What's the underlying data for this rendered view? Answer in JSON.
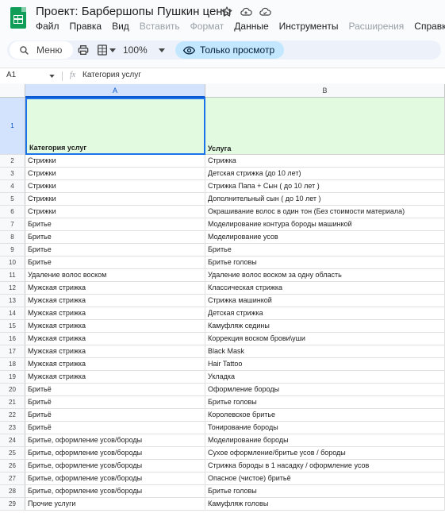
{
  "app": {
    "title": "Проект: Барбершопы Пушкин цены",
    "menus": [
      {
        "label": "Файл",
        "dim": false
      },
      {
        "label": "Правка",
        "dim": false
      },
      {
        "label": "Вид",
        "dim": false
      },
      {
        "label": "Вставить",
        "dim": true
      },
      {
        "label": "Формат",
        "dim": true
      },
      {
        "label": "Данные",
        "dim": false
      },
      {
        "label": "Инструменты",
        "dim": false
      },
      {
        "label": "Расширения",
        "dim": true
      },
      {
        "label": "Справка",
        "dim": false
      }
    ]
  },
  "toolbar": {
    "search_label": "Меню",
    "zoom": "100%",
    "view_only_label": "Только просмотр"
  },
  "formula_bar": {
    "cell_ref": "A1",
    "fx": "fx",
    "value": "Категория услуг"
  },
  "sheet": {
    "columns": [
      "A",
      "B"
    ],
    "header_row_number": "1",
    "headers": [
      "Категория услуг",
      "Услуга"
    ],
    "rows": [
      {
        "num": "2",
        "a": "Стрижки",
        "b": "Стрижка"
      },
      {
        "num": "3",
        "a": "Стрижки",
        "b": "Детская стрижка (до 10 лет)"
      },
      {
        "num": "4",
        "a": "Стрижки",
        "b": "Стрижка Папа + Сын ( до 10 лет )"
      },
      {
        "num": "5",
        "a": "Стрижки",
        "b": "Дополнительный сын ( до 10 лет )"
      },
      {
        "num": "6",
        "a": "Стрижки",
        "b": "Окрашивание волос в один тон (Без стоимости материала)"
      },
      {
        "num": "7",
        "a": "Бритье",
        "b": "Моделирование контура бороды машинкой"
      },
      {
        "num": "8",
        "a": "Бритье",
        "b": "Моделирование усов"
      },
      {
        "num": "9",
        "a": "Бритье",
        "b": "Бритье"
      },
      {
        "num": "10",
        "a": "Бритье",
        "b": "Бритье головы"
      },
      {
        "num": "11",
        "a": "Удаление волос воском",
        "b": "Удаление волос воском за одну область"
      },
      {
        "num": "12",
        "a": "Мужская стрижка",
        "b": "Классическая стрижка"
      },
      {
        "num": "13",
        "a": "Мужская стрижка",
        "b": "Стрижка машинкой"
      },
      {
        "num": "14",
        "a": "Мужская стрижка",
        "b": "Детская стрижка"
      },
      {
        "num": "15",
        "a": "Мужская стрижка",
        "b": "Камуфляж седины"
      },
      {
        "num": "16",
        "a": "Мужская стрижка",
        "b": "Коррекция воском брови\\уши"
      },
      {
        "num": "17",
        "a": "Мужская стрижка",
        "b": "Black Mask"
      },
      {
        "num": "18",
        "a": "Мужская стрижка",
        "b": "Hair Tattoo"
      },
      {
        "num": "19",
        "a": "Мужская стрижка",
        "b": "Укладка"
      },
      {
        "num": "20",
        "a": "Бритьё",
        "b": "Оформление бороды"
      },
      {
        "num": "21",
        "a": "Бритьё",
        "b": "Бритье головы"
      },
      {
        "num": "22",
        "a": "Бритьё",
        "b": "Королевское бритье"
      },
      {
        "num": "23",
        "a": "Бритьё",
        "b": "Тонирование бороды"
      },
      {
        "num": "24",
        "a": "Бритье, оформление усов/бороды",
        "b": "Моделирование бороды"
      },
      {
        "num": "25",
        "a": "Бритье, оформление усов/бороды",
        "b": "Сухое оформление/бритье усов / бороды"
      },
      {
        "num": "26",
        "a": "Бритье, оформление усов/бороды",
        "b": "Стрижка бороды в 1 насадку / оформление усов"
      },
      {
        "num": "27",
        "a": "Бритье, оформление усов/бороды",
        "b": "Опасное (чистое) бритьё"
      },
      {
        "num": "28",
        "a": "Бритье, оформление усов/бороды",
        "b": "Бритье головы"
      },
      {
        "num": "29",
        "a": "Прочие услуги",
        "b": "Камуфляж головы"
      }
    ]
  },
  "colors": {
    "header_fill": "#e2fbe0",
    "selection": "#1a73e8",
    "view_only_pill": "#c2e7ff",
    "logo": "#0f9d58"
  }
}
